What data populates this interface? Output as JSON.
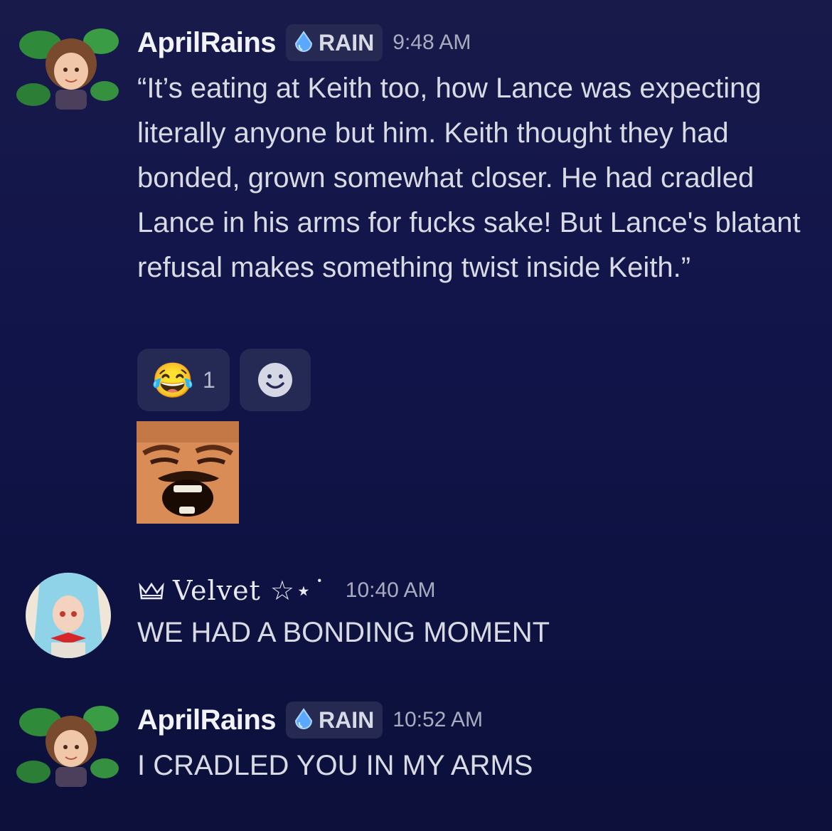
{
  "messages": [
    {
      "username": "AprilRains",
      "tag": "RAIN",
      "time": "9:48 AM",
      "text": "“It’s eating at Keith too, how Lance was expecting literally anyone but him. Keith thought they had bonded, grown somewhat closer. He had cradled Lance in his arms for fucks sake! But Lance's blatant refusal makes something twist inside Keith.”",
      "reactions": [
        {
          "emoji": "😂",
          "count": "1"
        }
      ],
      "add_reaction_icon": "smiley-icon",
      "sticker": "laughing-face-emoji"
    },
    {
      "username": "Velvet ☆⋆˙",
      "crown_icon": "crown-icon",
      "time": "10:40 AM",
      "text": "WE HAD A BONDING MOMENT"
    },
    {
      "username": "AprilRains",
      "tag": "RAIN",
      "time": "10:52 AM",
      "text": "I CRADLED YOU IN MY ARMS"
    }
  ],
  "colors": {
    "background": "#12154a",
    "tag_bg": "#262a52",
    "reaction_bg": "#252a55",
    "drop_icon": "#5aa8ff"
  }
}
